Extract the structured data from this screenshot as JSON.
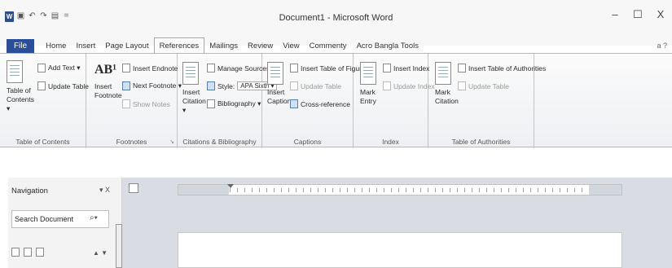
{
  "window": {
    "title": "Document1 - Microsoft Word",
    "quick_access": [
      "word-icon",
      "save-icon",
      "undo-icon",
      "redo-icon",
      "print-preview-icon",
      "customize-icon"
    ],
    "controls": [
      "–",
      "☐",
      "X"
    ]
  },
  "tabs": {
    "file": "File",
    "items": [
      "Home",
      "Insert",
      "Page Layout",
      "References",
      "Mailings",
      "Review",
      "View",
      "Commenty",
      "Acro Bangla Tools"
    ],
    "active": "References",
    "help": "a ?"
  },
  "ribbon": {
    "toc": {
      "label": "Table of Contents",
      "toc_button": "Table of Contents ▾",
      "add_text": "Add Text ▾",
      "update_table": "Update Table"
    },
    "footnotes": {
      "label": "Footnotes",
      "insert_footnote": "Insert Footnote",
      "insert_endnote": "Insert Endnote",
      "next_footnote": "Next Footnote ▾",
      "show_notes": "Show Notes"
    },
    "citations": {
      "label": "Citations & Bibliography",
      "insert_citation": "Insert Citation ▾",
      "manage_sources": "Manage Sources",
      "style_label": "Style:",
      "style_value": "APA Sixth ▾",
      "bibliography": "Bibliography ▾"
    },
    "captions": {
      "label": "Captions",
      "insert_caption": "Insert Caption",
      "insert_table_of_figures": "Insert Table of Figures",
      "update_table": "Update Table",
      "cross_reference": "Cross-reference"
    },
    "index": {
      "label": "Index",
      "mark_entry": "Mark Entry",
      "insert_index": "Insert Index",
      "update_index": "Update Index"
    },
    "authorities": {
      "label": "Table of Authorities",
      "mark_citation": "Mark Citation",
      "insert_table": "Insert Table of Authorities",
      "update_table": "Update Table"
    }
  },
  "navigation": {
    "title": "Navigation",
    "close": "▾ X",
    "search_placeholder": "Search Document",
    "search_icon": "magnifier-icon",
    "arrows": "▲ ▼"
  }
}
